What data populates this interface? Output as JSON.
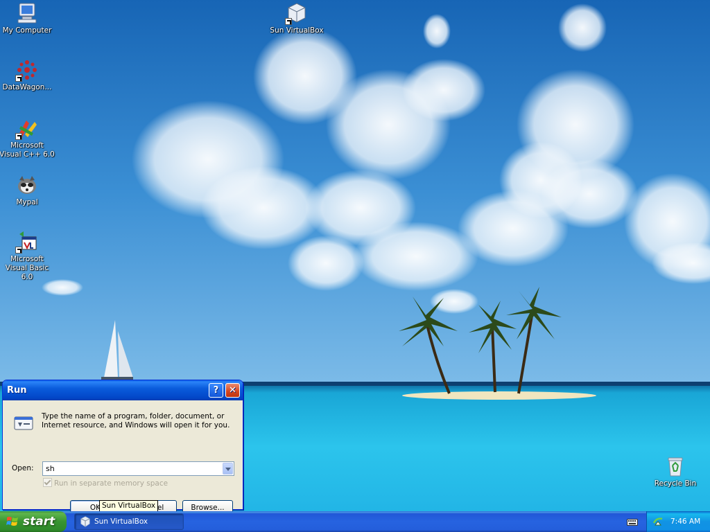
{
  "desktop": {
    "icons": [
      {
        "label": "My Computer"
      },
      {
        "label": "DataWagon..."
      },
      {
        "label": "Microsoft Visual C++ 6.0"
      },
      {
        "label": "Mypal"
      },
      {
        "label": "Microsoft Visual Basic 6.0"
      },
      {
        "label": "Sun VirtualBox"
      },
      {
        "label": "Recycle Bin"
      }
    ]
  },
  "run_dialog": {
    "title": "Run",
    "help_label": "?",
    "close_label": "✕",
    "description": "Type the name of a program, folder, document, or Internet resource, and Windows will open it for you.",
    "open_label": "Open:",
    "open_value": "sh",
    "separate_memory_label": "Run in separate memory space",
    "ok_label": "OK",
    "cancel_label": "Cancel",
    "browse_label": "Browse..."
  },
  "tooltip": {
    "text": "Sun VirtualBox"
  },
  "taskbar": {
    "start_label": "start",
    "tasks": [
      {
        "label": "Sun VirtualBox"
      }
    ],
    "clock": "7:46 AM"
  }
}
